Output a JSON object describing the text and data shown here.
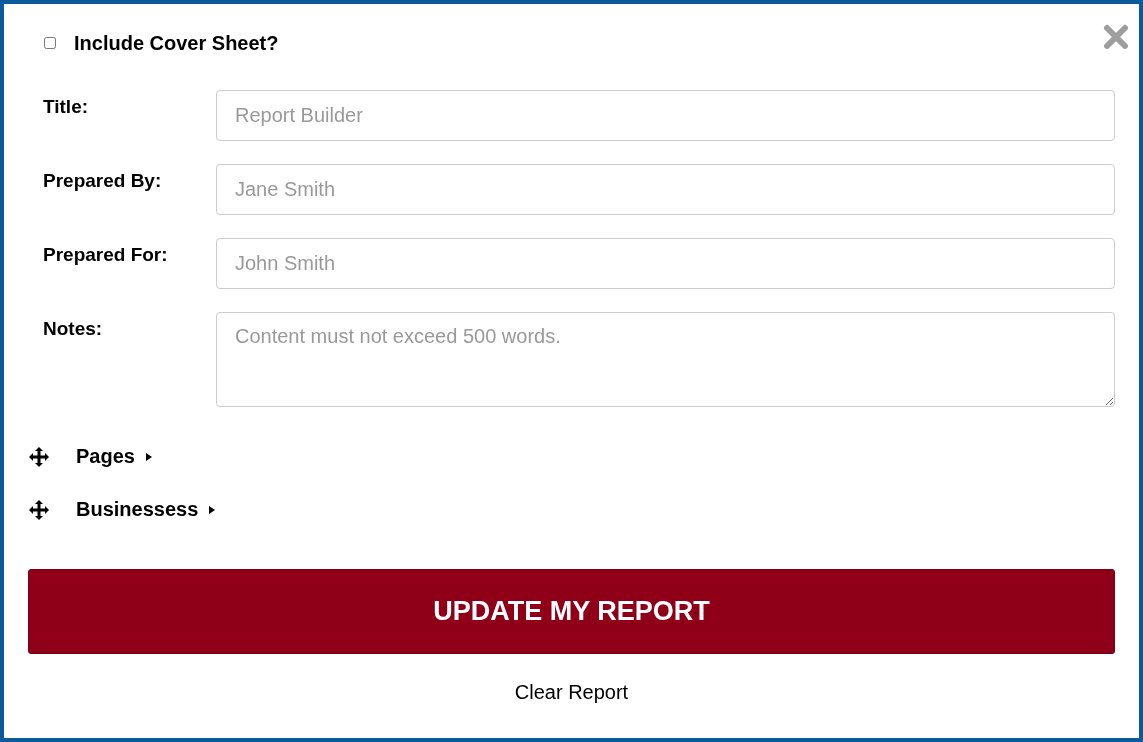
{
  "cover_sheet": {
    "label": "Include Cover Sheet?",
    "checked": false
  },
  "fields": [
    {
      "kind": "input",
      "label": "Title:",
      "placeholder": "Report Builder"
    },
    {
      "kind": "input",
      "label": "Prepared By:",
      "placeholder": "Jane Smith"
    },
    {
      "kind": "input",
      "label": "Prepared For:",
      "placeholder": "John Smith"
    },
    {
      "kind": "textarea",
      "label": "Notes:",
      "placeholder": "Content must not exceed 500 words."
    }
  ],
  "sections": [
    {
      "label": "Pages",
      "expanded": false
    },
    {
      "label": "Businessess",
      "expanded": false
    }
  ],
  "update_button": "UPDATE MY REPORT",
  "clear_link": "Clear Report"
}
